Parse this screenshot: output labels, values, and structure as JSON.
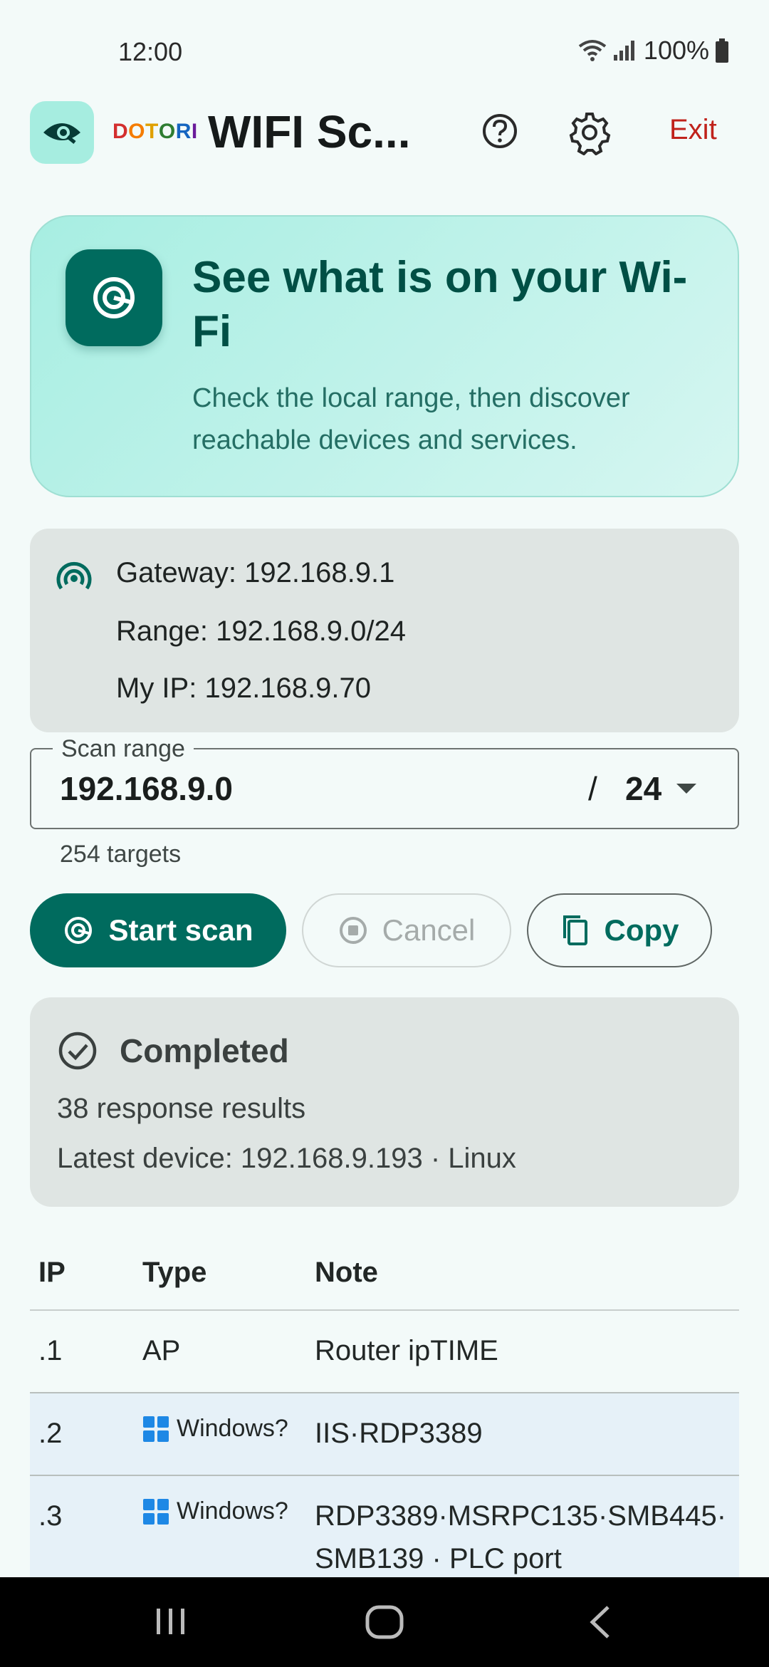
{
  "status_bar": {
    "time": "12:00",
    "battery": "100%"
  },
  "app_bar": {
    "brand": [
      "D",
      "O",
      "T",
      "O",
      "R",
      "I"
    ],
    "brand_colors": [
      "#d32f2f",
      "#f57c00",
      "#f9a825",
      "#2e7d32",
      "#1565c0",
      "#6a1b9a"
    ],
    "title": "WIFI Sc...",
    "exit_label": "Exit"
  },
  "hero": {
    "title": "See what is on your Wi-Fi",
    "subtitle": "Check the local range, then discover reachable devices and services."
  },
  "network": {
    "gateway": "Gateway: 192.168.9.1",
    "range": "Range: 192.168.9.0/24",
    "my_ip": "My IP: 192.168.9.70"
  },
  "scan_range": {
    "label": "Scan range",
    "ip": "192.168.9.0",
    "slash": "/",
    "prefix": "24",
    "targets": "254 targets"
  },
  "actions": {
    "start": "Start scan",
    "cancel": "Cancel",
    "copy": "Copy"
  },
  "status": {
    "title": "Completed",
    "results": "38 response results",
    "latest": "Latest device: 192.168.9.193 · Linux"
  },
  "table": {
    "headers": {
      "ip": "IP",
      "type": "Type",
      "note": "Note"
    },
    "rows": [
      {
        "ip": ".1",
        "type": "AP",
        "note": "Router ipTIME"
      },
      {
        "ip": ".2",
        "type": "Windows?",
        "note": "IIS·RDP3389"
      },
      {
        "ip": ".3",
        "type": "Windows?",
        "note": "RDP3389·MSRPC135·SMB445·SMB139 · PLC port"
      }
    ]
  },
  "colors": {
    "accent": "#006b5e",
    "exit": "#c0221b",
    "windows_blue": "#1e88e5"
  }
}
